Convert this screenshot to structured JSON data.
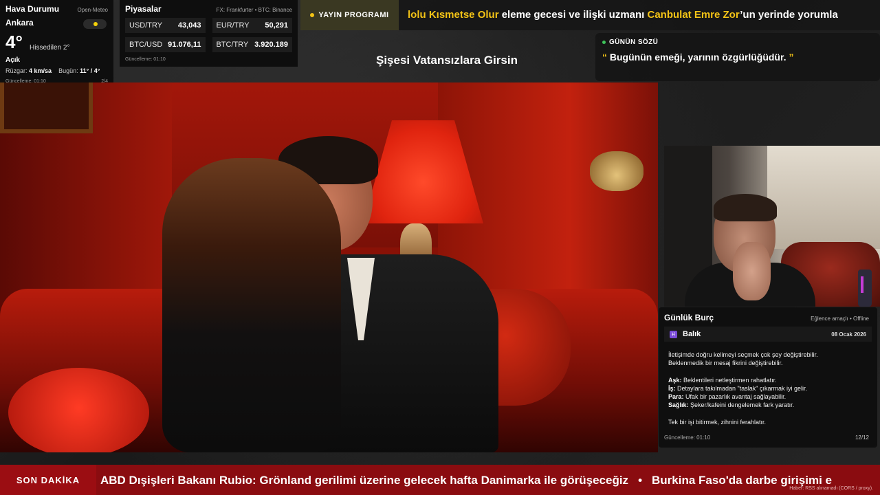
{
  "weather": {
    "title": "Hava Durumu",
    "source": "Open-Meteo",
    "city": "Ankara",
    "temp": "4°",
    "feels": "Hissedilen 2°",
    "condition": "Açık",
    "wind_label": "Rüzgar:",
    "wind_value": "4 km/sa",
    "today_label": "Bugün:",
    "today_value": "11° / 4°",
    "updated": "Güncelleme: 01:10",
    "page": "2/4"
  },
  "markets": {
    "title": "Piyasalar",
    "source": "FX: Frankfurter • BTC: Binance",
    "items": [
      {
        "label": "USD/TRY",
        "value": "43,043"
      },
      {
        "label": "EUR/TRY",
        "value": "50,291"
      },
      {
        "label": "BTC/USD",
        "value": "91.076,11"
      },
      {
        "label": "BTC/TRY",
        "value": "3.920.189"
      }
    ],
    "updated": "Güncelleme: 01:10"
  },
  "schedule": {
    "badge": "YAYIN PROGRAMI",
    "text_highlight_1": "lolu Kısmetse Olur",
    "text_1": " eleme gecesi ve ilişki uzmanı ",
    "text_highlight_2": "Canbulat Emre Zor",
    "text_2": "’un yerinde yorumla"
  },
  "show_title": "Şişesi Vatansızlara Girsin",
  "quote": {
    "label": "GÜNÜN SÖZÜ",
    "open_mark": "“",
    "text": " Bugünün emeği, yarının özgürlüğüdür. ",
    "close_mark": "”"
  },
  "horoscope": {
    "title": "Günlük Burç",
    "tag": "Eğlence amaçlı • Offline",
    "symbol": "♓",
    "sign": "Balık",
    "date": "08 Ocak 2026",
    "line1": "İletişimde doğru kelimeyi seçmek çok şey değiştirebilir.",
    "line2": "Beklenmedik bir mesaj fikrini değiştirebilir.",
    "love_label": "Aşk:",
    "love": " Beklentileri netleştirmen rahatlatır.",
    "work_label": "İş:",
    "work": " Detaylara takılmadan \"taslak\" çıkarmak iyi gelir.",
    "money_label": "Para:",
    "money": " Ufak bir pazarlık avantaj sağlayabilir.",
    "health_label": "Sağlık:",
    "health": " Şeker/kafeini dengelemek fark yaratır.",
    "closing": "Tek bir işi bitirmek, zihnini ferahlatır.",
    "updated": "Güncelleme: 01:10",
    "page": "12/12"
  },
  "breaking": {
    "badge": "SON DAKİKA",
    "headline_1": "ABD Dışişleri Bakanı Rubio: Grönland gerilimi üzerine gelecek hafta Danimarka ile görüşeceğiz",
    "separator": "•",
    "headline_2": "Burkina Faso'da darbe girişimi e",
    "error": "Haber: RSS alınamadı (CORS / proxy)."
  },
  "colors": {
    "accent_yellow": "#f3c316",
    "breaking_red": "#8a0c10",
    "live_green": "#3ec45a"
  }
}
